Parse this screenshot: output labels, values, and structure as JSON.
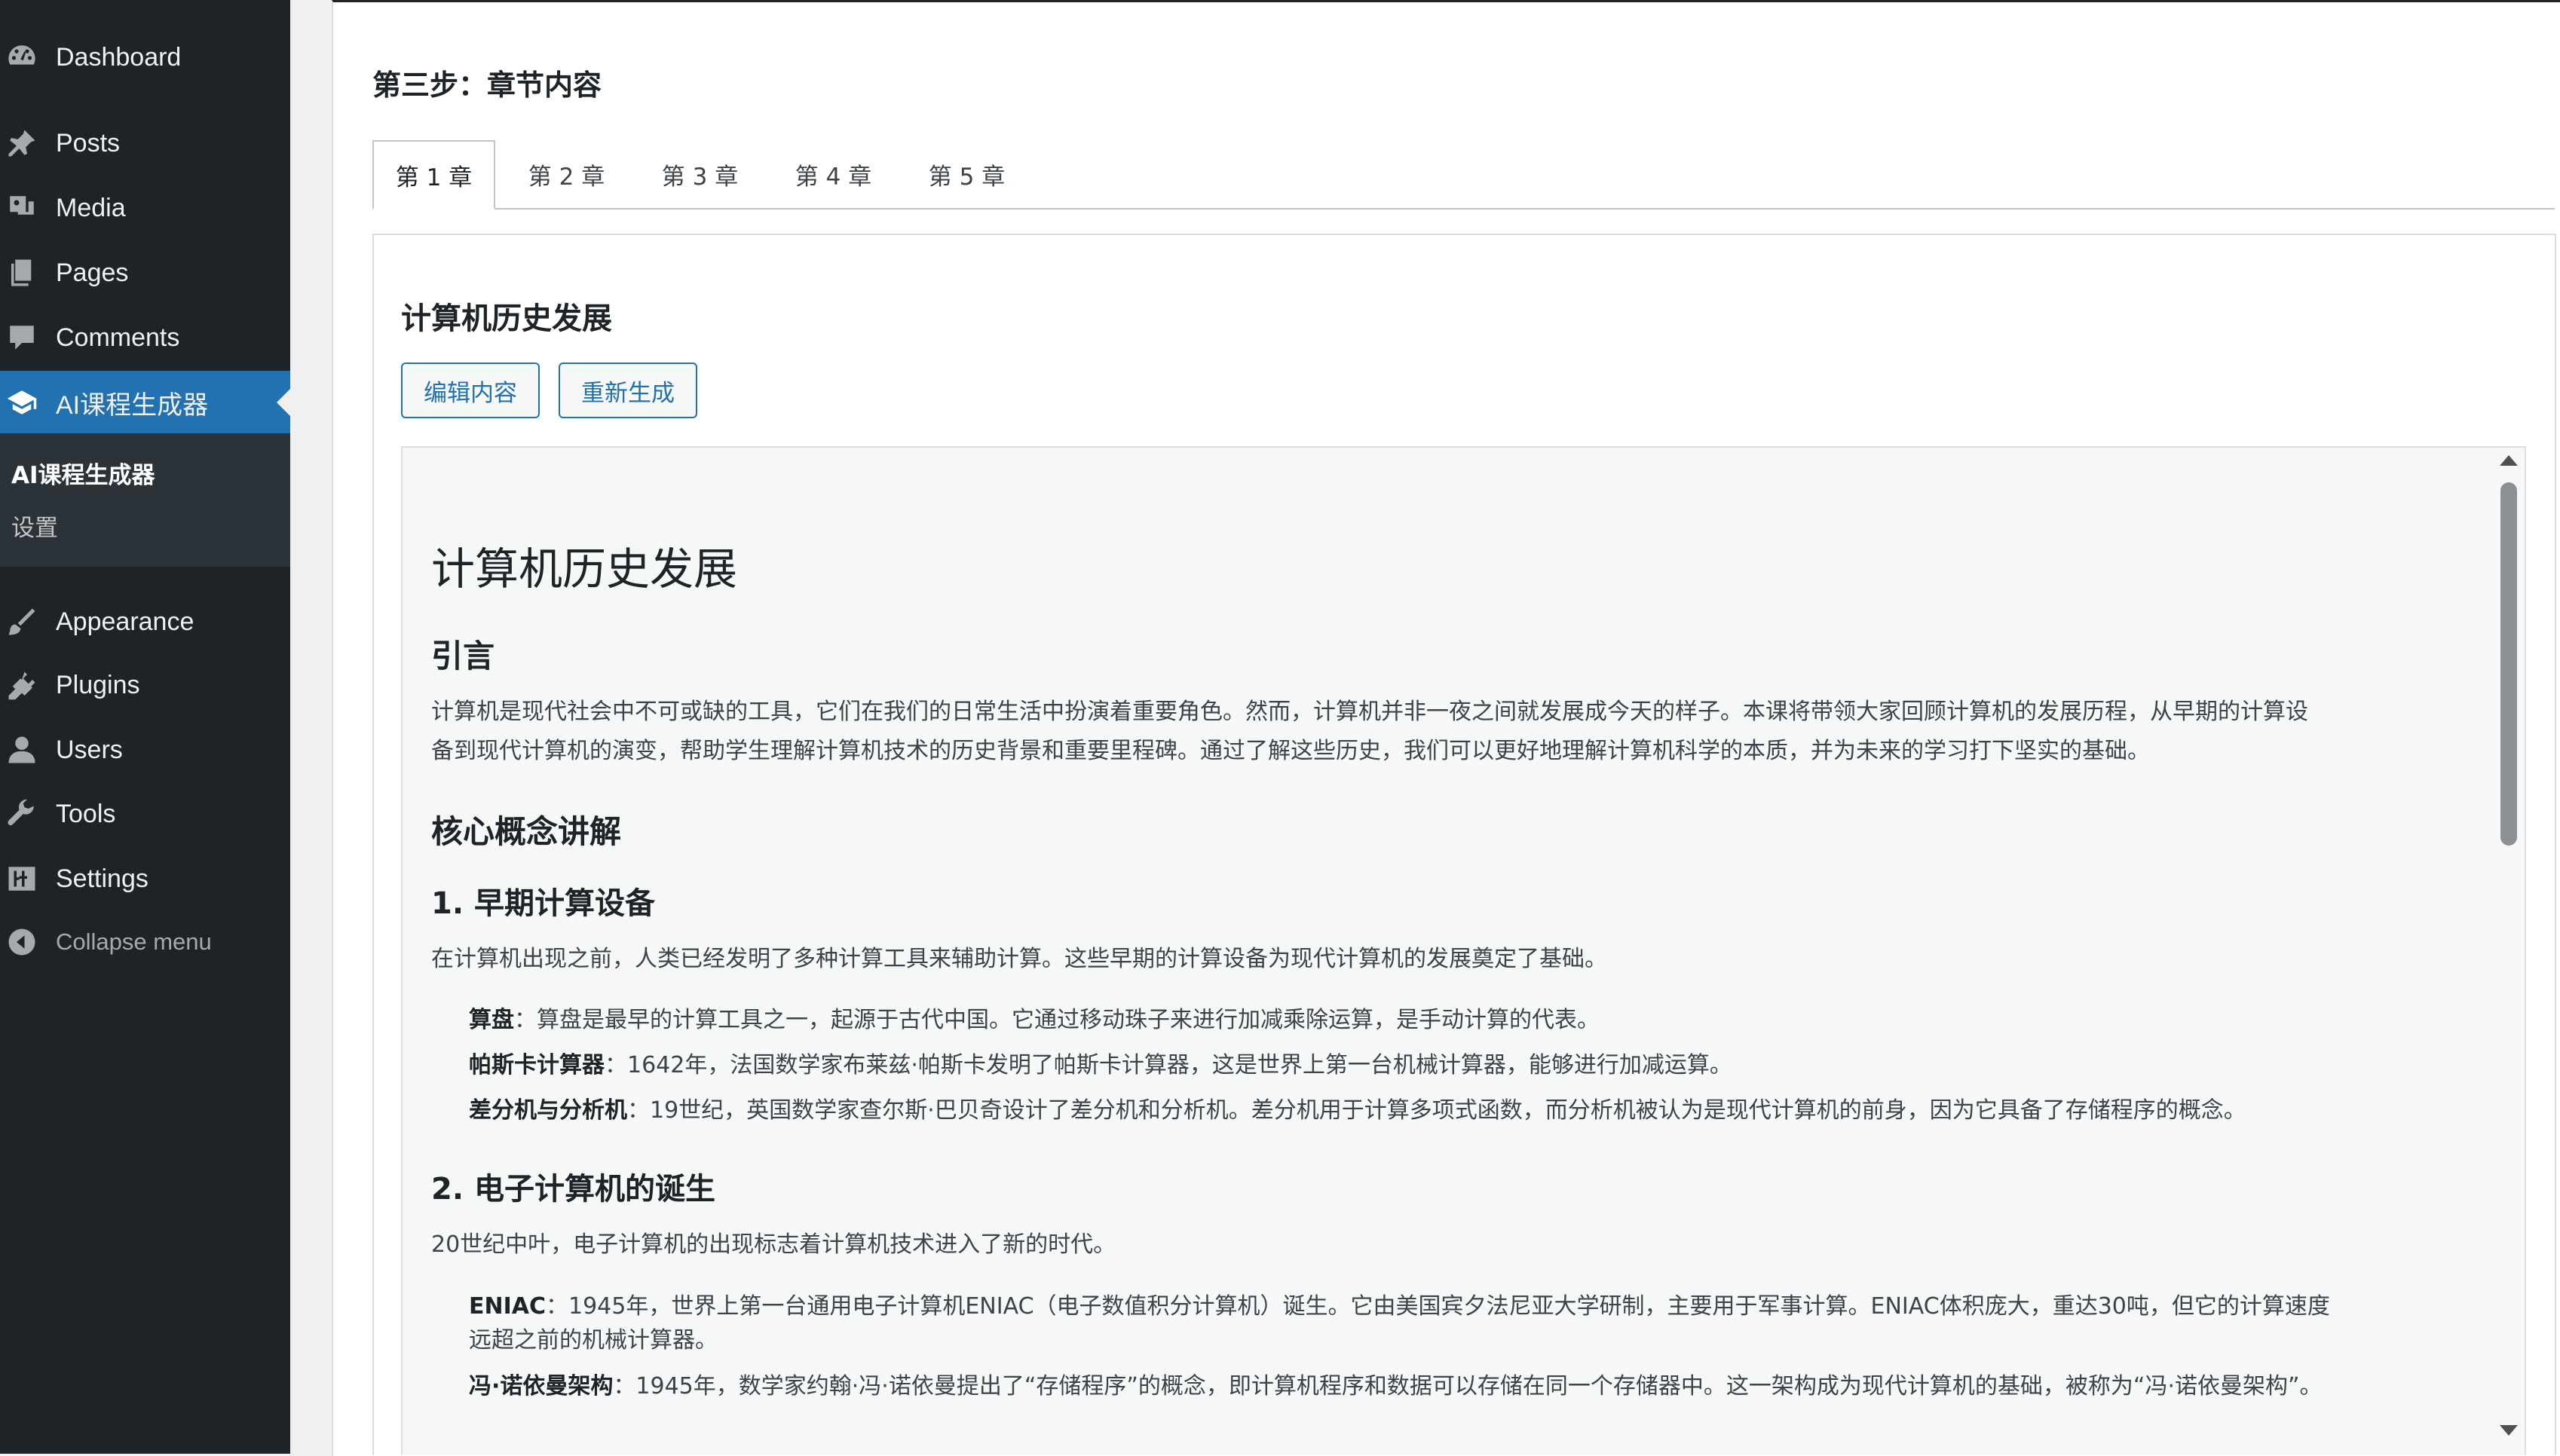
{
  "sidebar": {
    "items": [
      {
        "label": "Dashboard",
        "icon": "dashboard-icon"
      },
      {
        "label": "Posts",
        "icon": "pin-icon"
      },
      {
        "label": "Media",
        "icon": "media-icon"
      },
      {
        "label": "Pages",
        "icon": "pages-icon"
      },
      {
        "label": "Comments",
        "icon": "comment-icon"
      },
      {
        "label": "AI课程生成器",
        "icon": "graduation-cap-icon",
        "active": true
      },
      {
        "label": "Appearance",
        "icon": "paintbrush-icon"
      },
      {
        "label": "Plugins",
        "icon": "plugin-icon"
      },
      {
        "label": "Users",
        "icon": "user-icon"
      },
      {
        "label": "Tools",
        "icon": "wrench-icon"
      },
      {
        "label": "Settings",
        "icon": "settings-icon"
      },
      {
        "label": "Collapse menu",
        "icon": "collapse-icon"
      }
    ],
    "submenu": [
      "AI课程生成器",
      "设置"
    ]
  },
  "main": {
    "step_title": "第三步：章节内容",
    "tabs": [
      "第 1 章",
      "第 2 章",
      "第 3 章",
      "第 4 章",
      "第 5 章"
    ],
    "active_tab": 0,
    "chapter_title": "计算机历史发展",
    "buttons": {
      "edit": "编辑内容",
      "regenerate": "重新生成"
    }
  },
  "document": {
    "h1": "计算机历史发展",
    "intro_heading": "引言",
    "intro_line1": "计算机是现代社会中不可或缺的工具，它们在我们的日常生活中扮演着重要角色。然而，计算机并非一夜之间就发展成今天的样子。本课将带领大家回顾计算机的发展历程，从早期的计算设",
    "intro_line2": "备到现代计算机的演变，帮助学生理解计算机技术的历史背景和重要里程碑。通过了解这些历史，我们可以更好地理解计算机科学的本质，并为未来的学习打下坚实的基础。",
    "core_heading": "核心概念讲解",
    "s1_heading": "1. 早期计算设备",
    "s1_intro": "在计算机出现之前，人类已经发明了多种计算工具来辅助计算。这些早期的计算设备为现代计算机的发展奠定了基础。",
    "s1_items": [
      {
        "term": "算盘",
        "text": "：算盘是最早的计算工具之一，起源于古代中国。它通过移动珠子来进行加减乘除运算，是手动计算的代表。"
      },
      {
        "term": "帕斯卡计算器",
        "text": "：1642年，法国数学家布莱兹·帕斯卡发明了帕斯卡计算器，这是世界上第一台机械计算器，能够进行加减运算。"
      },
      {
        "term": "差分机与分析机",
        "text": "：19世纪，英国数学家查尔斯·巴贝奇设计了差分机和分析机。差分机用于计算多项式函数，而分析机被认为是现代计算机的前身，因为它具备了存储程序的概念。"
      }
    ],
    "s2_heading": "2. 电子计算机的诞生",
    "s2_intro": "20世纪中叶，电子计算机的出现标志着计算机技术进入了新的时代。",
    "s2_items": [
      {
        "term": "ENIAC",
        "text_line1": "：1945年，世界上第一台通用电子计算机ENIAC（电子数值积分计算机）诞生。它由美国宾夕法尼亚大学研制，主要用于军事计算。ENIAC体积庞大，重达30吨，但它的计算速度",
        "text_line2": "远超之前的机械计算器。"
      },
      {
        "term": "冯·诺依曼架构",
        "text": "：1945年，数学家约翰·冯·诺依曼提出了“存储程序”的概念，即计算机程序和数据可以存储在同一个存储器中。这一架构成为现代计算机的基础，被称为“冯·诺依曼架构”。"
      }
    ]
  }
}
